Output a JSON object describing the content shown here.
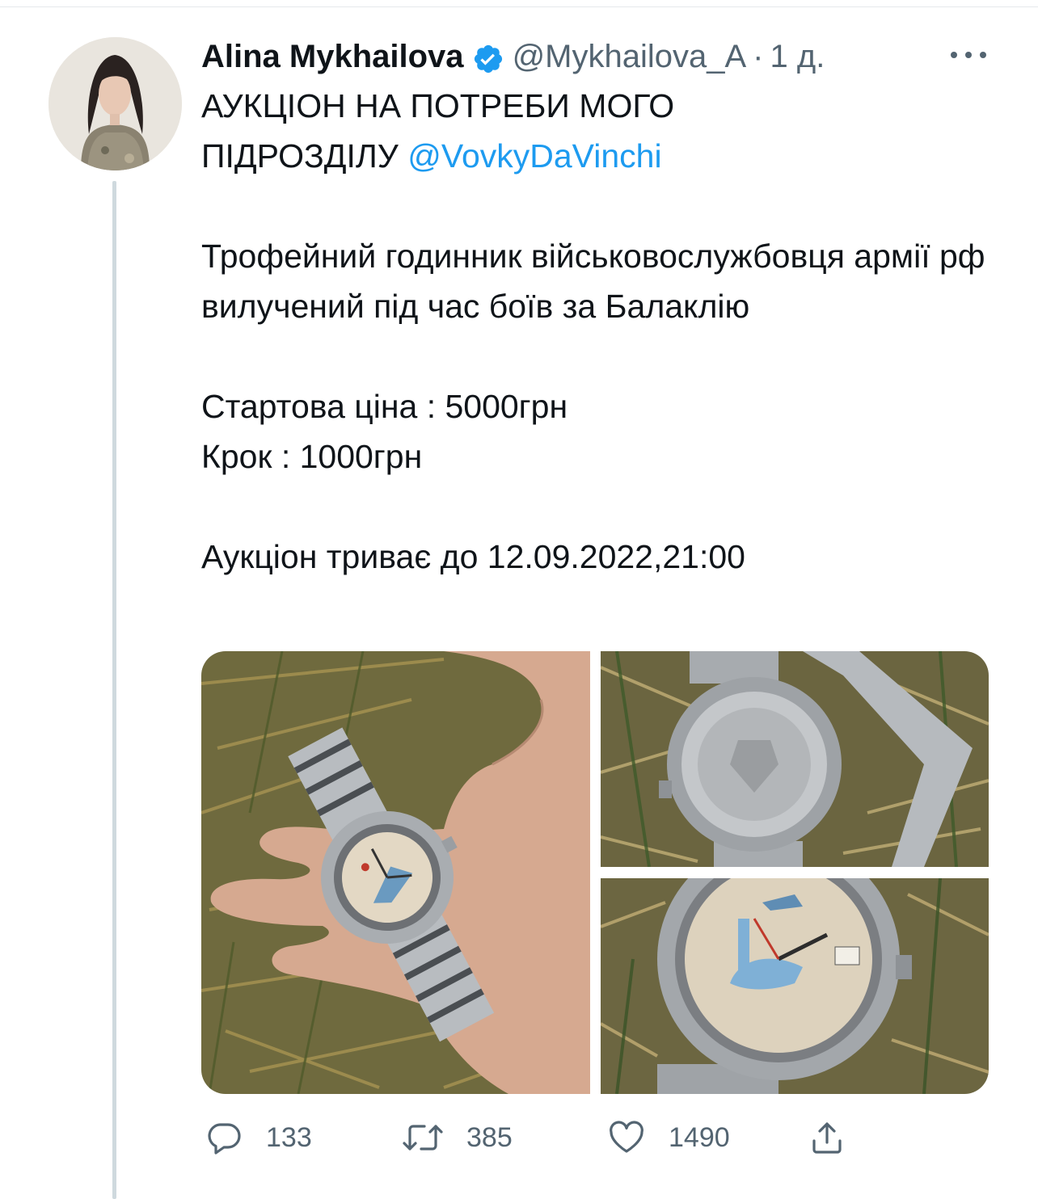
{
  "tweet": {
    "author_name": "Alina Mykhailova",
    "handle": "@Mykhailova_A",
    "separator": "·",
    "time": "1 д.",
    "text": {
      "line1": "АУКЦІОН НА ПОТРЕБИ МОГО",
      "line2_prefix": "ПІДРОЗДІЛУ ",
      "mention": "@VovkyDaVinchi",
      "paragraph2": "Трофейний годинник військовослужбовця армії рф вилучений під час боїв за Балаклію",
      "start_price": "Стартова ціна : 5000грн",
      "step": "Крок : 1000грн",
      "deadline": "Аукціон триває до 12.09.2022,21:00"
    },
    "counts": {
      "replies": "133",
      "retweets": "385",
      "likes": "1490"
    }
  },
  "colors": {
    "accent": "#1d9bf0",
    "text_primary": "#0f1419",
    "text_secondary": "#536471",
    "thread_line": "#cfd9de"
  },
  "icons": {
    "verified": "verified-badge-icon",
    "more": "more-dots-icon",
    "reply": "reply-bubble-icon",
    "retweet": "retweet-arrows-icon",
    "like": "heart-icon",
    "share": "share-upload-icon"
  },
  "images": [
    "photo of a wristwatch held in a hand over dry grass",
    "photo of the watch case back with russian coat of arms on grass",
    "close-up photo of the watch dial with submarine and plane on grass"
  ]
}
